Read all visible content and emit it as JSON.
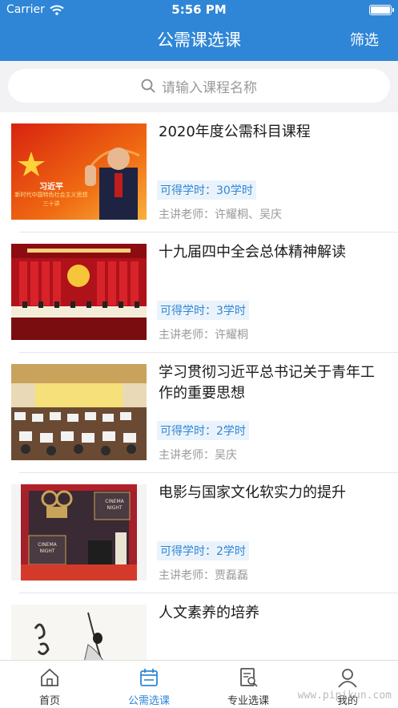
{
  "status_bar": {
    "carrier": "Carrier",
    "time": "5:56 PM"
  },
  "header": {
    "title": "公需课选课",
    "filter_label": "筛选"
  },
  "search": {
    "placeholder": "请输入课程名称"
  },
  "courses": [
    {
      "title": "2020年度公需科目课程",
      "hours": "可得学时：30学时",
      "teacher": "主讲老师：许耀桐、吴庆",
      "thumb_caption": "习近平",
      "thumb_subcaption": "新时代中国特色社会主义思想",
      "thumb_subcaption2": "三十讲"
    },
    {
      "title": "十九届四中全会总体精神解读",
      "hours": "可得学时：3学时",
      "teacher": "主讲老师：许耀桐"
    },
    {
      "title": "学习贯彻习近平总书记关于青年工作的重要思想",
      "hours": "可得学时：2学时",
      "teacher": "主讲老师：吴庆"
    },
    {
      "title": "电影与国家文化软实力的提升",
      "hours": "可得学时：2学时",
      "teacher": "主讲老师：贾磊磊",
      "thumb_caption": "CINEMA NIGHT",
      "thumb_caption2": "CINEMA NIGHT"
    },
    {
      "title": "人文素养的培养"
    }
  ],
  "tabs": [
    {
      "label": "首页",
      "icon": "home-icon"
    },
    {
      "label": "公需选课",
      "icon": "calendar-icon",
      "active": true
    },
    {
      "label": "专业选课",
      "icon": "document-search-icon"
    },
    {
      "label": "我的",
      "icon": "person-icon"
    }
  ],
  "watermark": "www.pipikun.com",
  "colors": {
    "primary": "#2f86d6",
    "hours_bg": "#eaf3fb",
    "search_bg": "#f2f2f4"
  }
}
